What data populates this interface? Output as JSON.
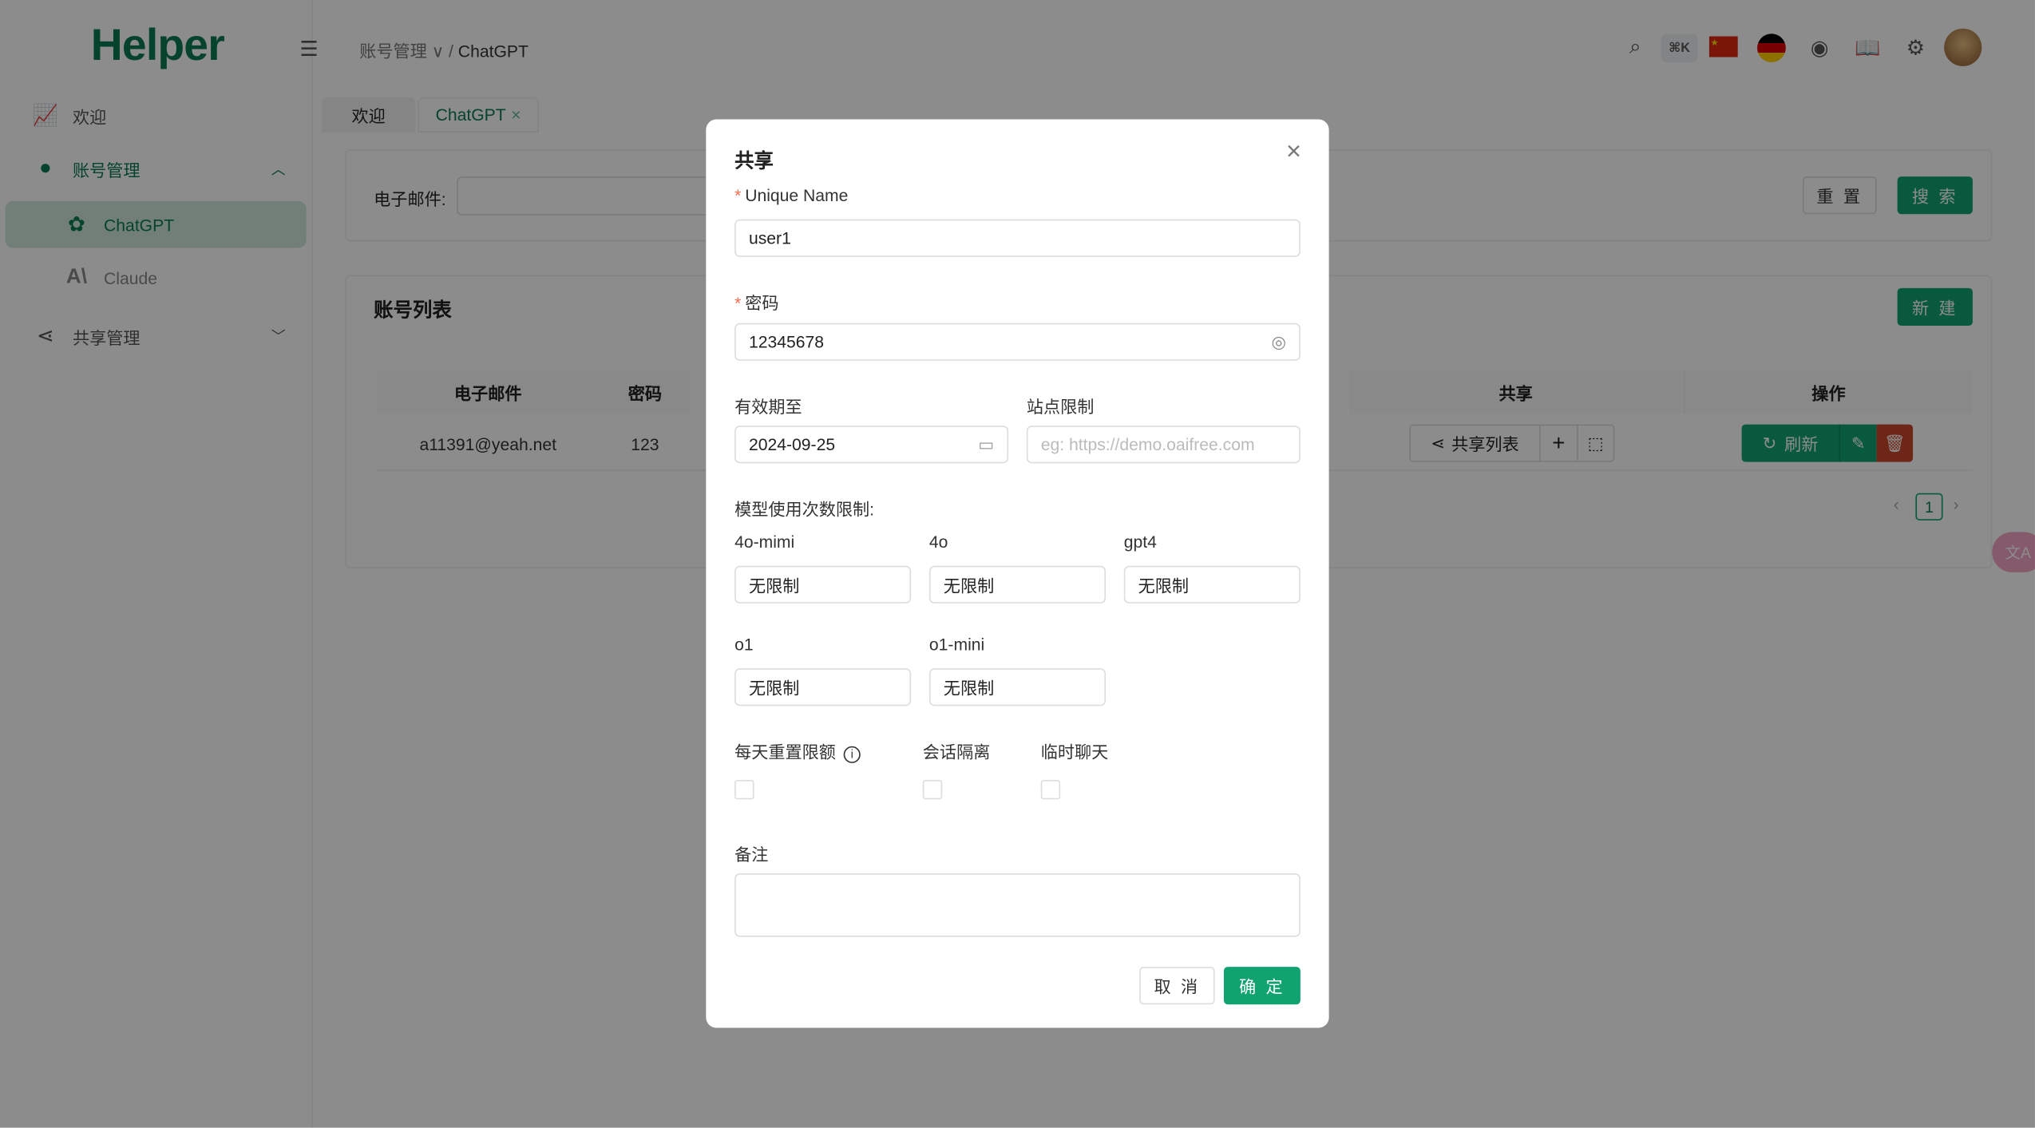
{
  "app": {
    "logo": "Helper"
  },
  "header": {
    "breadcrumb": {
      "parent": "账号管理",
      "current": "ChatGPT"
    },
    "shortcut": "⌘K",
    "icons": [
      "menu-fold-icon",
      "search-icon",
      "china-flag-icon",
      "german-flag-icon",
      "github-icon",
      "book-icon",
      "gear-icon",
      "avatar"
    ]
  },
  "sidebar": {
    "items": [
      {
        "label": "欢迎",
        "icon": "chart-icon"
      },
      {
        "label": "账号管理",
        "icon": "user-icon"
      },
      {
        "label": "ChatGPT",
        "icon": "openai-icon"
      },
      {
        "label": "Claude",
        "icon": "anthropic-icon"
      },
      {
        "label": "共享管理",
        "icon": "share-icon"
      }
    ]
  },
  "tabs": [
    {
      "label": "欢迎"
    },
    {
      "label": "ChatGPT"
    }
  ],
  "search": {
    "email_label": "电子邮件:",
    "reset": "重 置",
    "search": "搜 索"
  },
  "list": {
    "title": "账号列表",
    "new": "新 建",
    "columns": [
      "电子邮件",
      "密码",
      "共享",
      "操作"
    ],
    "rows": [
      {
        "email": "a11391@yeah.net",
        "password": "123",
        "share_list": "共享列表",
        "refresh": "刷新"
      }
    ],
    "page": "1"
  },
  "colors": {
    "accent": "#10a370",
    "danger": "#c9462b"
  },
  "modal": {
    "title": "共享",
    "unique_name_label": "Unique Name",
    "unique_name_value": "user1",
    "password_label": "密码",
    "password_value": "12345678",
    "expiry_label": "有效期至",
    "expiry_value": "2024-09-25",
    "site_label": "站点限制",
    "site_placeholder": "eg: https://demo.oaifree.com",
    "model_limit_label": "模型使用次数限制:",
    "models": [
      {
        "label": "4o-mimi",
        "value": "无限制"
      },
      {
        "label": "4o",
        "value": "无限制"
      },
      {
        "label": "gpt4",
        "value": "无限制"
      },
      {
        "label": "o1",
        "value": "无限制"
      },
      {
        "label": "o1-mini",
        "value": "无限制"
      }
    ],
    "checks": [
      {
        "label": "每天重置限额",
        "checked": false
      },
      {
        "label": "会话隔离",
        "checked": false
      },
      {
        "label": "临时聊天",
        "checked": false
      }
    ],
    "note_label": "备注",
    "note_value": "",
    "cancel": "取 消",
    "confirm": "确 定"
  }
}
